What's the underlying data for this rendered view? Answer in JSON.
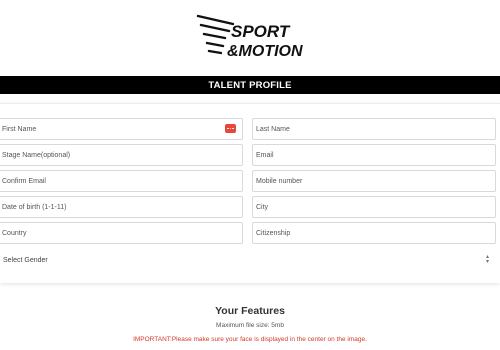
{
  "logo": {
    "line1": "SPORT",
    "line2": "&MOTION"
  },
  "page_title": "TALENT PROFILE",
  "form": {
    "first_name": "First Name",
    "last_name": "Last Name",
    "stage_name": "Stage Name(optional)",
    "email": "Email",
    "confirm_email": "Confirm Email",
    "mobile": "Mobile number",
    "dob": "Date of birth (1-1-11)",
    "city": "City",
    "country": "Country",
    "citizenship": "Citizenship",
    "gender": "Select Gender"
  },
  "features": {
    "title": "Your Features",
    "max_size": "Maximum file size: 5mb",
    "important": "IMPORTANT:Please make sure your face is displayed in the center on the image."
  },
  "colors": {
    "title_bar": "#000000",
    "warning": "#d23b2a",
    "autofill_icon": "#e8473c"
  },
  "icons": {
    "autofill": "password-manager-icon",
    "select": "up-down-caret-icon"
  }
}
